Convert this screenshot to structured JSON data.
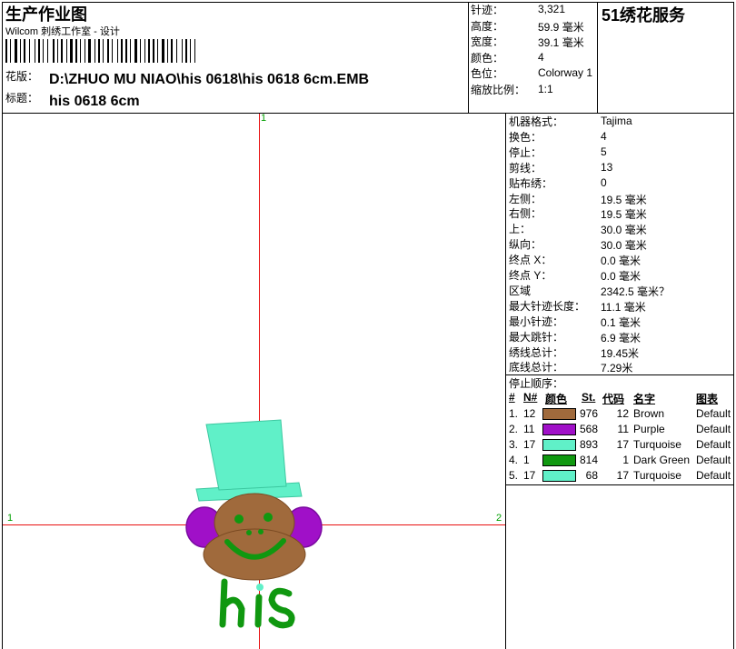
{
  "header": {
    "title": "生产作业图",
    "subtitle": "Wilcom 刺绣工作室 - 设计",
    "design_label": "花版：",
    "design_path": "D:\\ZHUO MU NIAO\\his 0618\\his 0618 6cm.EMB",
    "name_label": "标题：",
    "design_name": "his  0618 6cm",
    "brand": "51绣花服务"
  },
  "summary": [
    {
      "label": "针迹：",
      "value": "3,321"
    },
    {
      "label": "高度：",
      "value": "59.9 毫米"
    },
    {
      "label": "宽度：",
      "value": "39.1 毫米"
    },
    {
      "label": "颜色：",
      "value": "4"
    },
    {
      "label": "色位：",
      "value": "Colorway 1"
    },
    {
      "label": "缩放比例：",
      "value": "1:1"
    }
  ],
  "details": [
    {
      "label": "机器格式：",
      "value": "Tajima"
    },
    {
      "label": "换色：",
      "value": "4"
    },
    {
      "label": "停止：",
      "value": "5"
    },
    {
      "label": "剪线：",
      "value": "13"
    },
    {
      "label": "贴布绣：",
      "value": "0"
    },
    {
      "label": "左侧：",
      "value": "19.5 毫米"
    },
    {
      "label": "右侧：",
      "value": "19.5 毫米"
    },
    {
      "label": "上：",
      "value": "30.0 毫米"
    },
    {
      "label": "纵向：",
      "value": "30.0 毫米"
    },
    {
      "label": "终点 X：",
      "value": "0.0 毫米"
    },
    {
      "label": "终点 Y：",
      "value": "0.0 毫米"
    },
    {
      "label": "区域",
      "value": "2342.5 毫米？"
    },
    {
      "label": "最大针迹长度：",
      "value": "11.1 毫米"
    },
    {
      "label": "最小针迹：",
      "value": "0.1 毫米"
    },
    {
      "label": "最大跳针：",
      "value": "6.9 毫米"
    },
    {
      "label": "绣线总计：",
      "value": "19.45米"
    },
    {
      "label": "底线总计：",
      "value": "7.29米"
    }
  ],
  "stop_sequence": {
    "title": "停止顺序：",
    "headers": {
      "num": "#",
      "n": "N#",
      "color": "颜色",
      "st": "St.",
      "code": "代码",
      "name": "名字",
      "chart": "图表"
    },
    "rows": [
      {
        "num": "1.",
        "n": "12",
        "color": "#a06a3c",
        "st": "976",
        "code": "12",
        "name": "Brown",
        "chart": "Default"
      },
      {
        "num": "2.",
        "n": "11",
        "color": "#a010c8",
        "st": "568",
        "code": "11",
        "name": "Purple",
        "chart": "Default"
      },
      {
        "num": "3.",
        "n": "17",
        "color": "#60f0c8",
        "st": "893",
        "code": "17",
        "name": "Turquoise",
        "chart": "Default"
      },
      {
        "num": "4.",
        "n": "1",
        "color": "#109810",
        "st": "814",
        "code": "1",
        "name": "Dark Green",
        "chart": "Default"
      },
      {
        "num": "5.",
        "n": "17",
        "color": "#60f0c8",
        "st": "68",
        "code": "17",
        "name": "Turquoise",
        "chart": "Default"
      }
    ]
  },
  "axes": {
    "top": "1",
    "left": "1",
    "right": "2"
  },
  "colors": {
    "crosshair": "#e81010",
    "axis_label": "#00a000"
  }
}
